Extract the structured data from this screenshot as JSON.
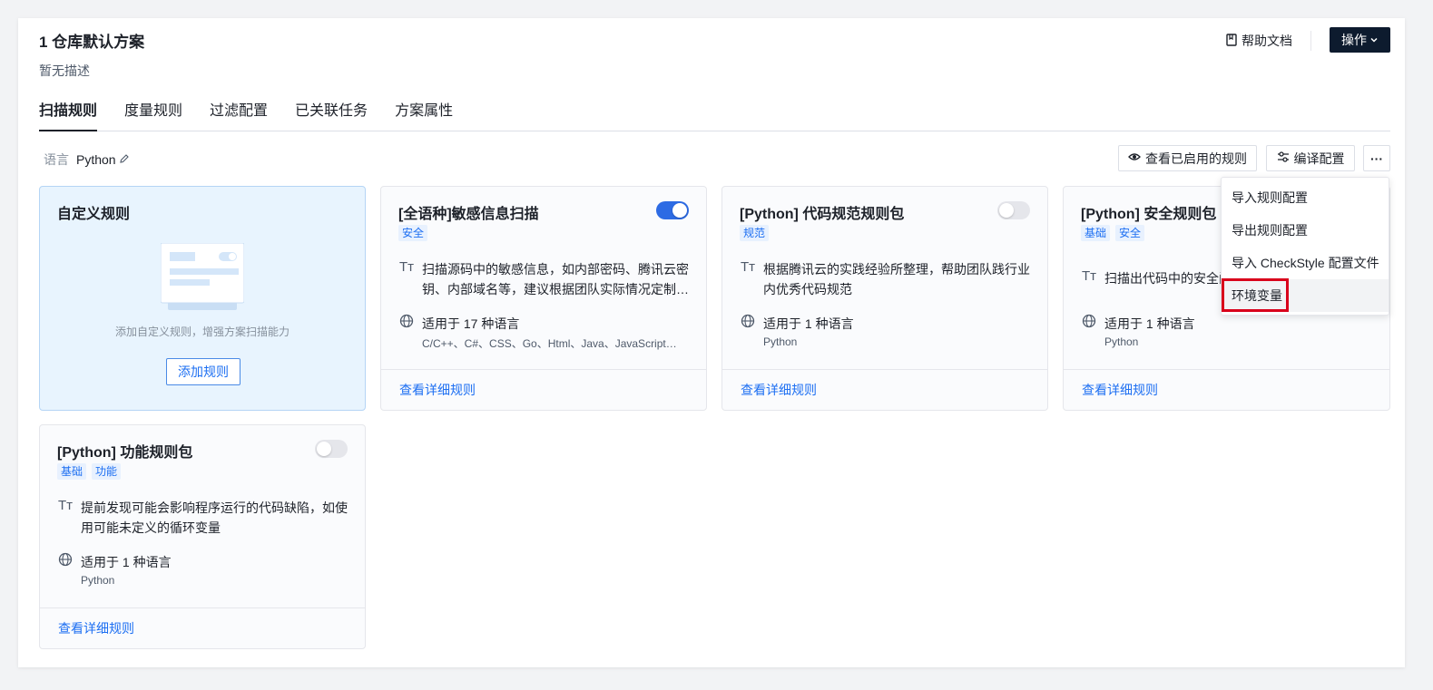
{
  "header": {
    "title": "1 仓库默认方案",
    "description": "暂无描述",
    "help_label": "帮助文档",
    "operation_label": "操作"
  },
  "tabs": [
    {
      "label": "扫描规则",
      "active": true
    },
    {
      "label": "度量规则",
      "active": false
    },
    {
      "label": "过滤配置",
      "active": false
    },
    {
      "label": "已关联任务",
      "active": false
    },
    {
      "label": "方案属性",
      "active": false
    }
  ],
  "toolbar": {
    "language_label": "语言",
    "language_value": "Python",
    "view_enabled_label": "查看已启用的规则",
    "compile_config_label": "编译配置",
    "more_label": "···"
  },
  "custom_card": {
    "title": "自定义规则",
    "hint": "添加自定义规则，增强方案扫描能力",
    "add_button": "添加规则"
  },
  "cards": [
    {
      "title": "[全语种]敏感信息扫描",
      "tags": [
        "安全"
      ],
      "enabled": true,
      "description": "扫描源码中的敏感信息，如内部密码、腾讯云密钥、内部域名等，建议根据团队实际情况定制规则",
      "languages_label": "适用于 17 种语言",
      "languages": "C/C++、C#、CSS、Go、Html、Java、JavaScript、Kotlin...",
      "link": "查看详细规则"
    },
    {
      "title": "[Python] 代码规范规则包",
      "tags": [
        "规范"
      ],
      "enabled": false,
      "description": "根据腾讯云的实践经验所整理，帮助团队践行业内优秀代码规范",
      "languages_label": "适用于 1 种语言",
      "languages": "Python",
      "link": "查看详细规则"
    },
    {
      "title": "[Python] 安全规则包",
      "tags": [
        "基础",
        "安全"
      ],
      "enabled": false,
      "description": "扫描出代码中的安全问题",
      "languages_label": "适用于 1 种语言",
      "languages": "Python",
      "link": "查看详细规则"
    },
    {
      "title": "[Python] 功能规则包",
      "tags": [
        "基础",
        "功能"
      ],
      "enabled": false,
      "description": "提前发现可能会影响程序运行的代码缺陷，如使用可能未定义的循环变量",
      "languages_label": "适用于 1 种语言",
      "languages": "Python",
      "link": "查看详细规则"
    }
  ],
  "menu": {
    "items": [
      "导入规则配置",
      "导出规则配置",
      "导入 CheckStyle 配置文件",
      "环境变量"
    ],
    "highlighted_index": 3
  },
  "colors": {
    "primary": "#1d6ff2",
    "toggle_on": "#2d6be4",
    "dark_button": "#0d1b2e",
    "highlight_box": "#d9001b"
  }
}
